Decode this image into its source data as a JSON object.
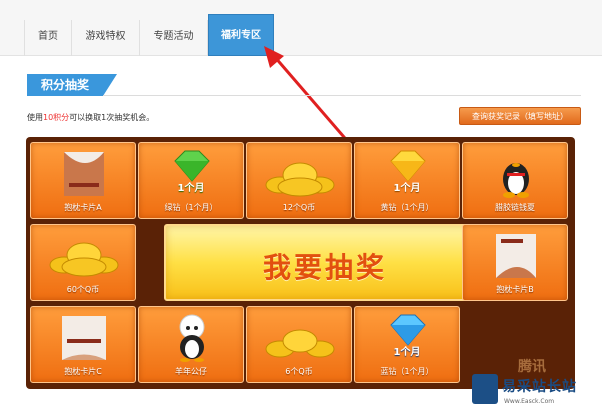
{
  "tabs": [
    {
      "label": "首页"
    },
    {
      "label": "游戏特权"
    },
    {
      "label": "专题活动"
    },
    {
      "label": "福利专区"
    }
  ],
  "section": {
    "title": "积分抽奖"
  },
  "hint": {
    "prefix": "使用",
    "points": "10积分",
    "suffix": "可以换取1次抽奖机会。"
  },
  "record_button": "查询获奖记录（填写地址）",
  "draw_button": "我要抽奖",
  "prizes": [
    {
      "label": "抱枕卡片A",
      "icon": "pillow-card-icon"
    },
    {
      "label": "绿钻（1个月）",
      "badge": "1个月",
      "icon": "green-diamond-icon"
    },
    {
      "label": "12个Q币",
      "icon": "q-coin-icon"
    },
    {
      "label": "黄钻（1个月）",
      "badge": "1个月",
      "icon": "yellow-diamond-icon"
    },
    {
      "label": "腊胶链钱夏",
      "icon": "qq-penguin-icon"
    },
    {
      "label": "60个Q币",
      "icon": "q-coin-icon"
    },
    {
      "label": "抱枕卡片B",
      "icon": "pillow-card-icon"
    },
    {
      "label": "抱枕卡片C",
      "icon": "pillow-card-icon"
    },
    {
      "label": "羊年公仔",
      "icon": "sheep-doll-icon"
    },
    {
      "label": "6个Q币",
      "icon": "q-coin-icon"
    },
    {
      "label": "蓝钻（1个月）",
      "badge": "1个月",
      "icon": "blue-diamond-icon"
    }
  ],
  "watermark": {
    "brand": "易采站长站",
    "url": "Www.Easck.Com",
    "top": "腾讯"
  },
  "colors": {
    "tab_active": "#3d96d8",
    "board": "#5a2206",
    "cell": "#f57f1f",
    "draw": "#ffe045",
    "accent_red": "#e33333"
  }
}
